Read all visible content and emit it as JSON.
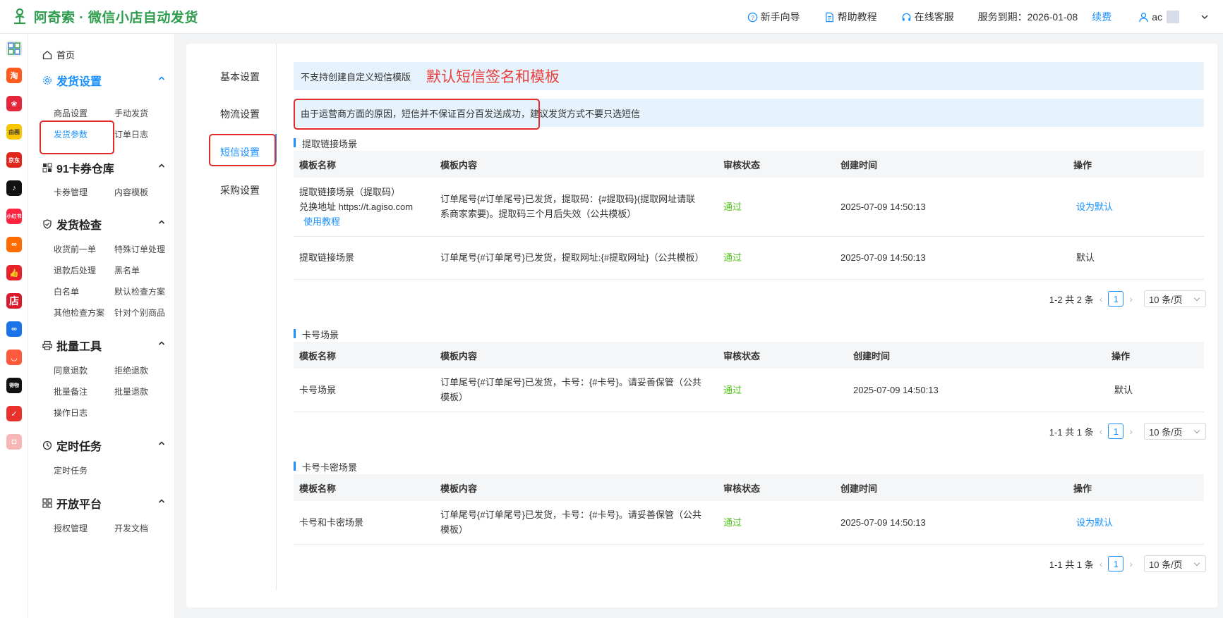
{
  "app": {
    "title": "阿奇索 · 微信小店自动发货",
    "accent": "#1890ff",
    "brand": "#2e9d4e",
    "highlight": "#e32a2a"
  },
  "topnav": {
    "guide": "新手向导",
    "help": "帮助教程",
    "service": "在线客服",
    "expiry": "服务到期：2026-01-08",
    "renew": "续费",
    "user": "ac"
  },
  "sidebar": {
    "home": "首页",
    "sections": [
      {
        "title": "发货设置",
        "links": [
          "商品设置",
          "手动发货",
          "发货参数",
          "订单日志"
        ]
      },
      {
        "title": "91卡券仓库",
        "links": [
          "卡券管理",
          "内容模板"
        ]
      },
      {
        "title": "发货检查",
        "links": [
          "收货前一单",
          "特殊订单处理",
          "退款后处理",
          "黑名单",
          "白名单",
          "默认检查方案",
          "其他检查方案",
          "针对个别商品"
        ]
      },
      {
        "title": "批量工具",
        "links": [
          "同意退款",
          "拒绝退款",
          "批量备注",
          "批量退款",
          "操作日志"
        ]
      },
      {
        "title": "定时任务",
        "links": [
          "定时任务"
        ]
      },
      {
        "title": "开放平台",
        "links": [
          "授权管理",
          "开发文档"
        ]
      }
    ]
  },
  "tabs": [
    "基本设置",
    "物流设置",
    "短信设置",
    "采购设置"
  ],
  "notice1": {
    "text": "不支持创建自定义短信模版",
    "annotation": "默认短信签名和模板"
  },
  "notice2": {
    "text": "由于运营商方面的原因，短信并不保证百分百发送成功，建议发货方式不要只选短信"
  },
  "columns": [
    "模板名称",
    "模板内容",
    "审核状态",
    "创建时间",
    "操作"
  ],
  "sections": [
    {
      "title": "提取链接场景",
      "rows": [
        {
          "name_line1": "提取链接场景（提取码）",
          "name_line2": "兑换地址 https://t.agiso.com",
          "name_link": "使用教程",
          "content": "订单尾号{#订单尾号}已发货，提取码：{#提取码}(提取网址请联系商家索要)。提取码三个月后失效（公共模板）",
          "status": "通过",
          "created": "2025-07-09 14:50:13",
          "action": "设为默认"
        },
        {
          "name": "提取链接场景",
          "content": "订单尾号{#订单尾号}已发货，提取网址:{#提取网址}（公共模板）",
          "status": "通过",
          "created": "2025-07-09 14:50:13",
          "action": "默认"
        }
      ],
      "pager": {
        "summary": "1-2 共 2 条",
        "page": "1",
        "size": "10 条/页"
      }
    },
    {
      "title": "卡号场景",
      "rows": [
        {
          "name": "卡号场景",
          "content": "订单尾号{#订单尾号}已发货，卡号：{#卡号}。请妥善保管（公共模板）",
          "status": "通过",
          "created": "2025-07-09 14:50:13",
          "action": "默认"
        }
      ],
      "pager": {
        "summary": "1-1 共 1 条",
        "page": "1",
        "size": "10 条/页"
      }
    },
    {
      "title": "卡号卡密场景",
      "rows": [
        {
          "name": "卡号和卡密场景",
          "content": "订单尾号{#订单尾号}已发货，卡号：{#卡号}。请妥善保管（公共模板）",
          "status": "通过",
          "created": "2025-07-09 14:50:13",
          "action": "设为默认"
        }
      ],
      "pager": {
        "summary": "1-1 共 1 条",
        "page": "1",
        "size": "10 条/页"
      }
    }
  ]
}
